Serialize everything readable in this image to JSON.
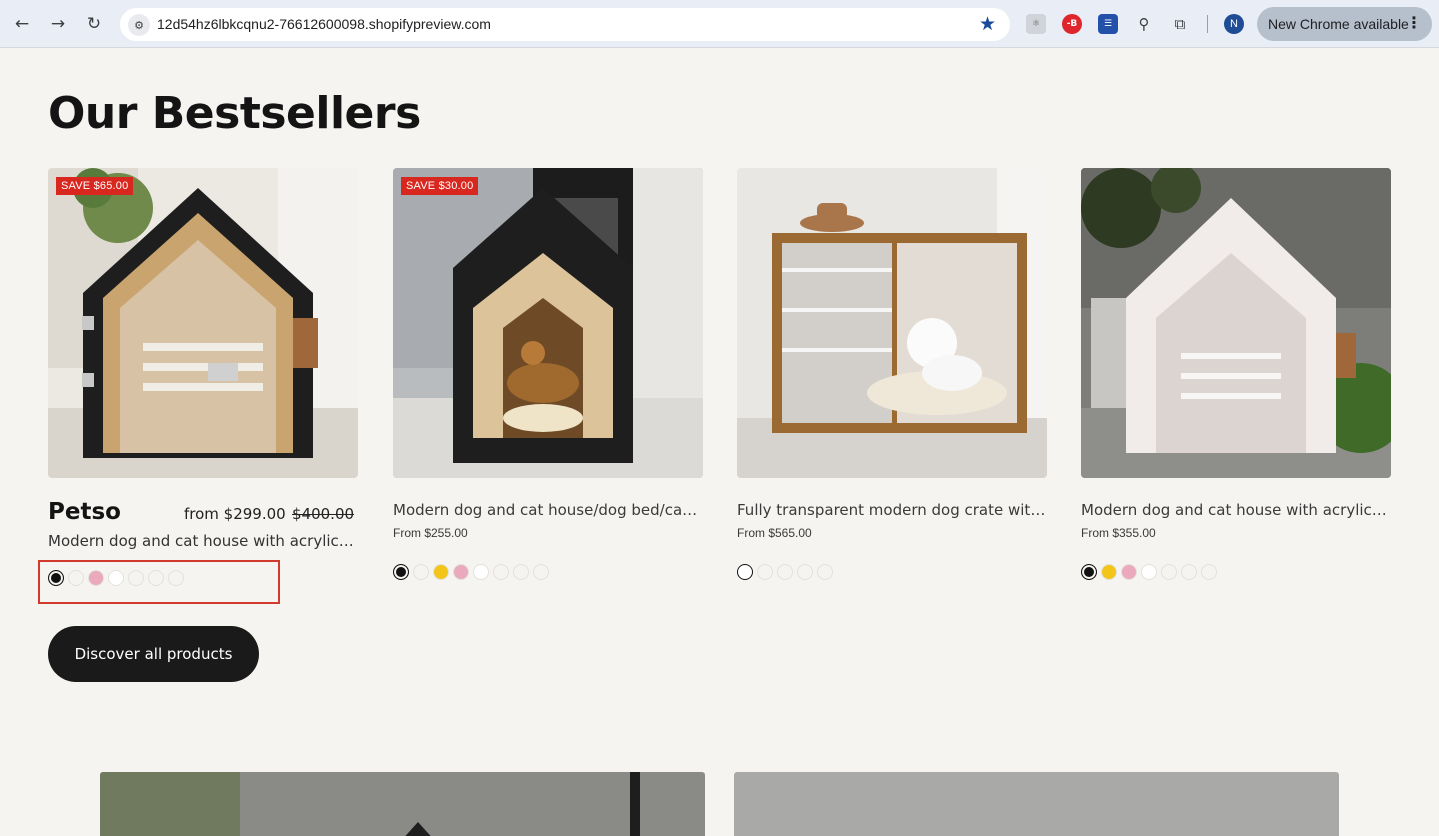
{
  "browser": {
    "url": "12d54hz6lbkcqnu2-76612600098.shopifypreview.com",
    "profile_initial": "N",
    "update_label": "New Chrome available",
    "icons": [
      "back-icon",
      "forward-icon",
      "reload-icon",
      "site-info-icon",
      "bookmark-star-icon",
      "extensions-puzzle-icon",
      "more-vert-icon"
    ]
  },
  "section": {
    "title": "Our Bestsellers",
    "button_label": "Discover all products"
  },
  "products": [
    {
      "badge": "SAVE $65.00",
      "brand": "Petso",
      "price_from": "from $299.00",
      "compare_price": "$400.00",
      "title": "Modern dog and cat house with acrylic door and pillow",
      "swatches": [
        "black",
        "empty",
        "pink",
        "white",
        "empty",
        "empty",
        "empty"
      ]
    },
    {
      "badge": "SAVE $30.00",
      "title": "Modern dog and cat house/dog bed/cat bed for medium dogs",
      "price": "From $255.00",
      "swatches": [
        "black",
        "empty",
        "yellow",
        "pink",
        "white",
        "empty",
        "empty",
        "empty"
      ]
    },
    {
      "title": "Fully transparent modern dog crate with sliding door",
      "price": "From $565.00",
      "swatches": [
        "empty-selected",
        "empty",
        "empty",
        "empty",
        "empty"
      ]
    },
    {
      "title": "Modern dog and cat house with acrylic door and pillow",
      "price": "From $355.00",
      "swatches": [
        "black",
        "yellow",
        "pink",
        "white",
        "empty",
        "empty",
        "empty"
      ]
    }
  ],
  "colors": {
    "page_bg": "#f5f4f0",
    "badge_red": "#d8271e",
    "button_dark": "#1a1a1a",
    "highlight_red": "#d33a2e"
  }
}
